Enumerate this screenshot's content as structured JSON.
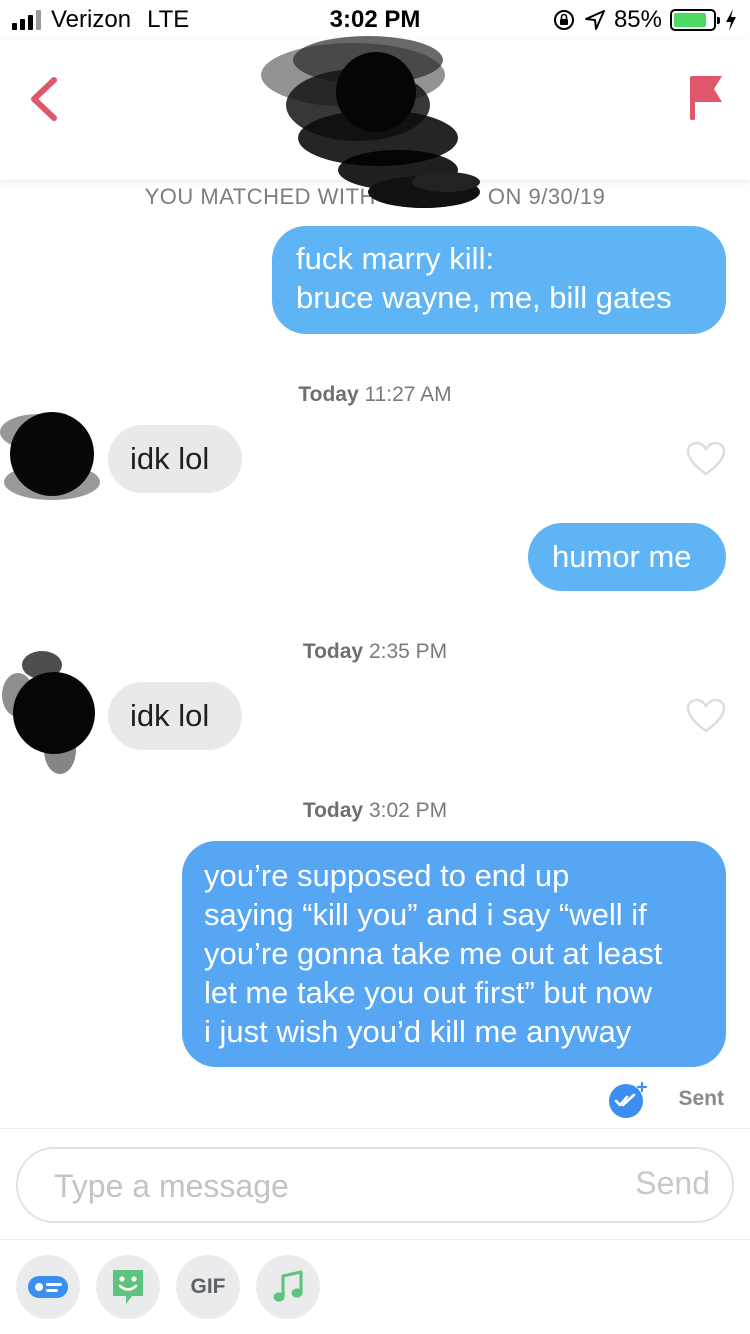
{
  "status_bar": {
    "carrier": "Verizon",
    "network": "LTE",
    "time": "3:02 PM",
    "battery_percent": "85%",
    "battery_level": 0.85
  },
  "header": {
    "back_icon": "chevron-left-icon",
    "report_icon": "flag-icon",
    "accent_color": "#e0566a"
  },
  "match_banner": {
    "prefix": "YOU MATCHED WITH",
    "suffix": "ON 9/30/19"
  },
  "messages": [
    {
      "direction": "out",
      "lines": [
        "fuck marry kill:",
        "bruce wayne, me, bill gates"
      ]
    },
    {
      "timestamp_day": "Today",
      "timestamp_time": "11:27 AM"
    },
    {
      "direction": "in",
      "text": "idk lol"
    },
    {
      "direction": "out",
      "text": "humor me"
    },
    {
      "timestamp_day": "Today",
      "timestamp_time": "2:35 PM"
    },
    {
      "direction": "in",
      "text": "idk lol"
    },
    {
      "timestamp_day": "Today",
      "timestamp_time": "3:02 PM"
    },
    {
      "direction": "out",
      "lines": [
        "you’re supposed to end up",
        "saying “kill you” and i say “well if",
        "you’re gonna take me out at least",
        "let me take you out first” but now",
        "i just wish you’d kill me anyway"
      ]
    }
  ],
  "receipt": {
    "label": "Sent",
    "icon": "read-receipt-icon"
  },
  "composer": {
    "placeholder": "Type a message",
    "send_label": "Send",
    "tools": [
      {
        "icon": "message-card-icon"
      },
      {
        "icon": "bitmoji-icon"
      },
      {
        "label": "GIF"
      },
      {
        "icon": "music-note-icon"
      }
    ]
  },
  "colors": {
    "outgoing_bubble": "#5fb4f5",
    "incoming_bubble": "#e9e9eb",
    "tool_blue": "#3b8ff0",
    "tool_green": "#5ec37f"
  }
}
